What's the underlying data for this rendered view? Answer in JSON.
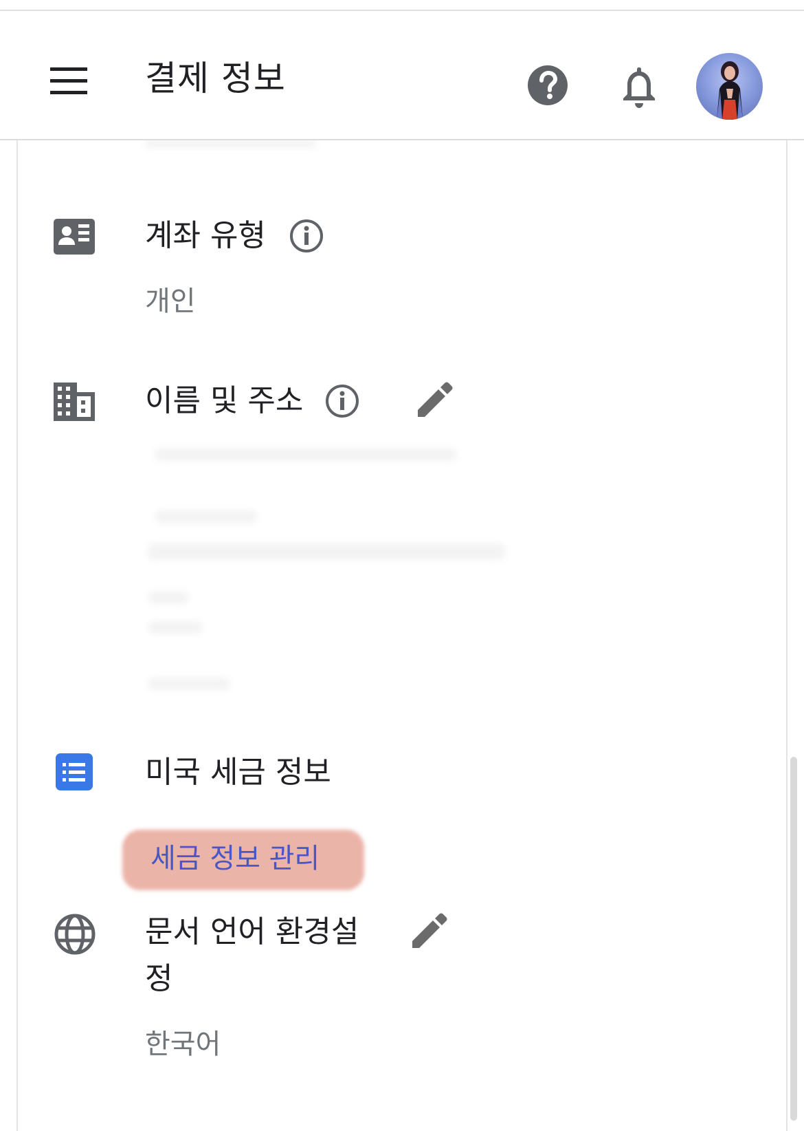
{
  "appbar": {
    "title": "결제 정보",
    "menu_icon": "hamburger-menu-icon",
    "help_icon": "help-circle-icon",
    "notifications_icon": "bell-icon",
    "avatar_icon": "user-avatar"
  },
  "sections": {
    "account_type": {
      "label": "계좌 유형",
      "value": "개인",
      "icon": "contact-card-icon"
    },
    "name_address": {
      "label": "이름 및 주소",
      "icon": "building-icon"
    },
    "us_tax": {
      "label": "미국 세금 정보",
      "link": "세금 정보 관리",
      "icon": "list-icon"
    },
    "doc_language": {
      "label_line1": "문서 언어 환경설",
      "label_line2": "정",
      "value": "한국어",
      "icon": "globe-icon"
    }
  },
  "colors": {
    "accent_blue": "#3b78e7",
    "link": "#4a56c8",
    "highlight": "#eab0a4",
    "icon_gray": "#5f6368"
  }
}
